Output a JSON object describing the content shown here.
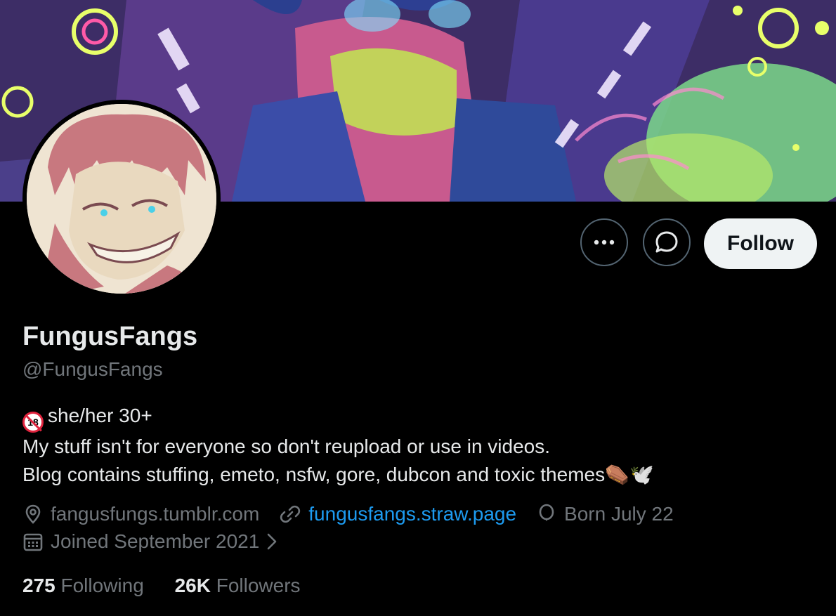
{
  "profile": {
    "display_name": "FungusFangs",
    "handle": "@FungusFangs",
    "bio": {
      "line1": "she/her 30+",
      "line2": "My stuff isn't for everyone so don't reupload or use in videos.",
      "line3": "Blog contains stuffing, emeto, nsfw, gore, dubcon and toxic themes",
      "line3_emoji": "⚰️🕊️"
    },
    "location": "fangusfungs.tumblr.com",
    "website": "fungusfangs.straw.page",
    "birthday": "Born July 22",
    "joined": "Joined September 2021"
  },
  "actions": {
    "follow_label": "Follow",
    "more_icon": "more-icon",
    "message_icon": "message-icon"
  },
  "stats": {
    "following_count": "275",
    "following_label": "Following",
    "followers_count": "26K",
    "followers_label": "Followers"
  },
  "colors": {
    "background": "#000000",
    "text_primary": "#e7e9ea",
    "text_secondary": "#71767b",
    "link": "#1d9bf0",
    "follow_button_bg": "#eff3f4"
  }
}
